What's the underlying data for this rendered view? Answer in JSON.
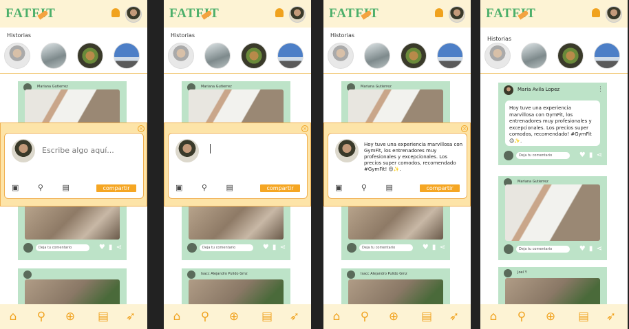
{
  "app": {
    "logo": "FATFIT",
    "stories_label": "Historias"
  },
  "users": {
    "mariana": "Mariana Gutierrez",
    "isaac": "Isacc Alejandro Pulido Gmz",
    "joel": "Joel Y",
    "maria": "Maria Avila Lopez"
  },
  "comment": {
    "placeholder": "Deja tu comentario"
  },
  "composer": {
    "placeholder": "Escribe algo aquí...",
    "share_label": "compartir",
    "post_text": "Hoy tuve una experiencia marvillosa con GymFit, los entrenadores muy profesionales y excepcionales. Los precios super comodos, recomendado #GymFit! 😊✨."
  },
  "post": {
    "text": "Hoy tuve una experiencia marvillosa con GymFit, los entrenadores muy profesionales y excepcionales. Los precios super comodos, recomendado! #GymFit 😊✨."
  },
  "icons": {
    "nav": [
      "home-icon",
      "search-icon",
      "add-icon",
      "clipboard-icon",
      "carrot-icon"
    ],
    "composer": [
      "image-icon",
      "location-icon",
      "video-icon"
    ],
    "comment": [
      "like-icon",
      "chat-icon",
      "share-icon"
    ]
  },
  "colors": {
    "accent": "#f5a623",
    "card": "#bde3c8",
    "header": "#fdf3d4"
  }
}
